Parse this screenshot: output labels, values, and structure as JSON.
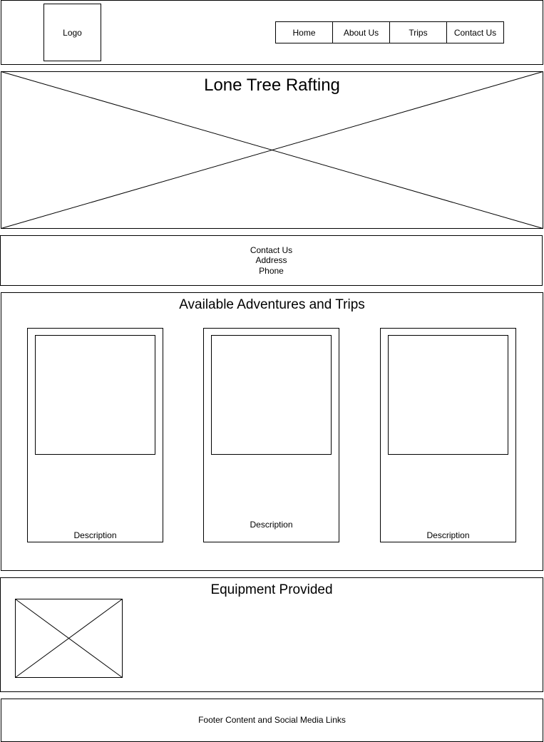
{
  "header": {
    "logo_label": "Logo",
    "nav": [
      {
        "label": "Home"
      },
      {
        "label": "About Us"
      },
      {
        "label": "Trips"
      },
      {
        "label": "Contact Us"
      }
    ]
  },
  "hero": {
    "title": "Lone Tree Rafting"
  },
  "contact": {
    "lines": [
      "Contact Us",
      "Address",
      "Phone"
    ]
  },
  "trips": {
    "title": "Available Adventures and Trips",
    "cards": [
      {
        "description": "Description"
      },
      {
        "description": "Description"
      },
      {
        "description": "Description"
      }
    ]
  },
  "equipment": {
    "title": "Equipment Provided"
  },
  "footer": {
    "text": "Footer Content and Social Media Links"
  }
}
